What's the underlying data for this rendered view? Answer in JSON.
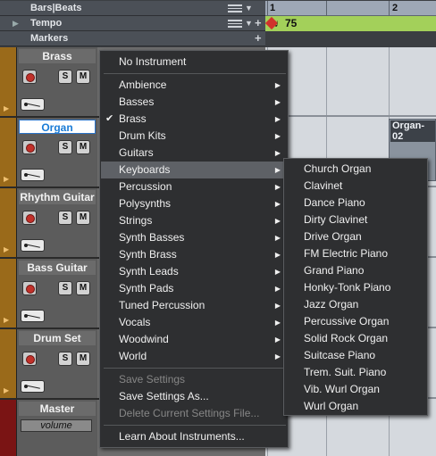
{
  "rulers": {
    "bars_beats": {
      "label": "Bars|Beats",
      "marks": [
        "1",
        "2"
      ]
    },
    "tempo": {
      "label": "Tempo",
      "value": "75"
    },
    "markers": {
      "label": "Markers"
    }
  },
  "tracks": [
    {
      "name": "Brass",
      "solo": "S",
      "mute": "M"
    },
    {
      "name": "Organ",
      "solo": "S",
      "mute": "M"
    },
    {
      "name": "Rhythm Guitar",
      "solo": "S",
      "mute": "M"
    },
    {
      "name": "Bass Guitar",
      "solo": "S",
      "mute": "M"
    },
    {
      "name": "Drum Set",
      "solo": "S",
      "mute": "M"
    },
    {
      "name": "Master",
      "volume": "volume"
    }
  ],
  "region": {
    "name": "Organ-02"
  },
  "menu": {
    "no_instrument": "No Instrument",
    "categories": [
      "Ambience",
      "Basses",
      "Brass",
      "Drum Kits",
      "Guitars",
      "Keyboards",
      "Percussion",
      "Polysynths",
      "Strings",
      "Synth Basses",
      "Synth Brass",
      "Synth Leads",
      "Synth Pads",
      "Tuned Percussion",
      "Vocals",
      "Woodwind",
      "World"
    ],
    "checked": "Brass",
    "highlighted": "Keyboards",
    "save_settings": "Save Settings",
    "save_settings_as": "Save Settings As...",
    "delete_settings": "Delete Current Settings File...",
    "learn": "Learn About Instruments..."
  },
  "submenu": {
    "items": [
      "Church Organ",
      "Clavinet",
      "Dance Piano",
      "Dirty Clavinet",
      "Drive Organ",
      "FM Electric Piano",
      "Grand Piano",
      "Honky-Tonk Piano",
      "Jazz Organ",
      "Percussive Organ",
      "Solid Rock Organ",
      "Suitcase Piano",
      "Trem. Suit. Piano",
      "Vib. Wurl Organ",
      "Wurl Organ"
    ]
  },
  "colors": {
    "menu_bg": "#2e2f31",
    "highlight": "#5e6166",
    "selected_track": "#1b7cd6",
    "tempo_lane": "#a3d05a",
    "record": "#c2312a"
  }
}
